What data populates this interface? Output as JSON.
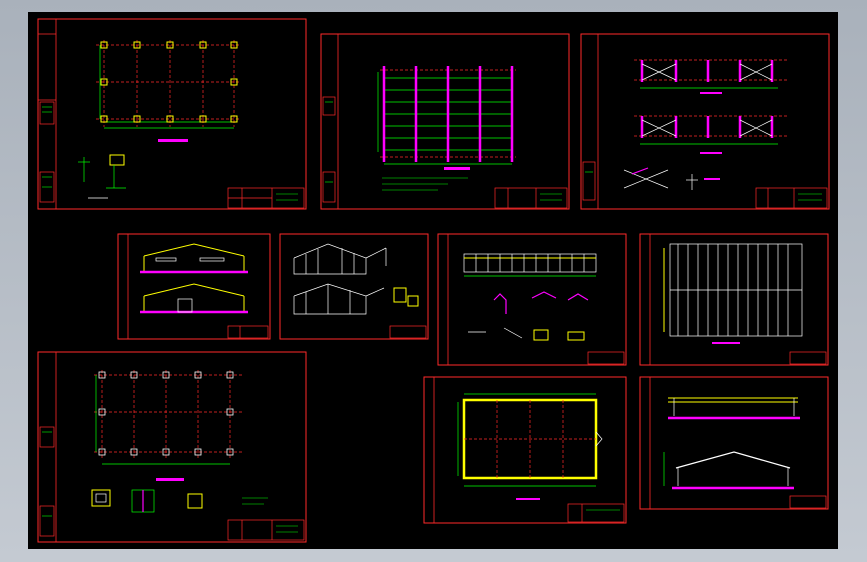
{
  "viewer": {
    "canvas_background": "#000000",
    "window_background": "#b7bec7"
  },
  "colors": {
    "border": "#ff2a2a",
    "dimension": "#00ff00",
    "structure": "#ff00ff",
    "axis": "#ffff00",
    "detail": "#ffffff"
  },
  "sheets": [
    {
      "id": "foundation-plan"
    },
    {
      "id": "purlin-layout-plan"
    },
    {
      "id": "bracing-layout"
    },
    {
      "id": "elevations"
    },
    {
      "id": "perspective-views"
    },
    {
      "id": "wall-elevation-details"
    },
    {
      "id": "roof-panel-layout"
    },
    {
      "id": "column-layout-plan"
    },
    {
      "id": "roof-plan"
    },
    {
      "id": "section-elevations"
    }
  ]
}
